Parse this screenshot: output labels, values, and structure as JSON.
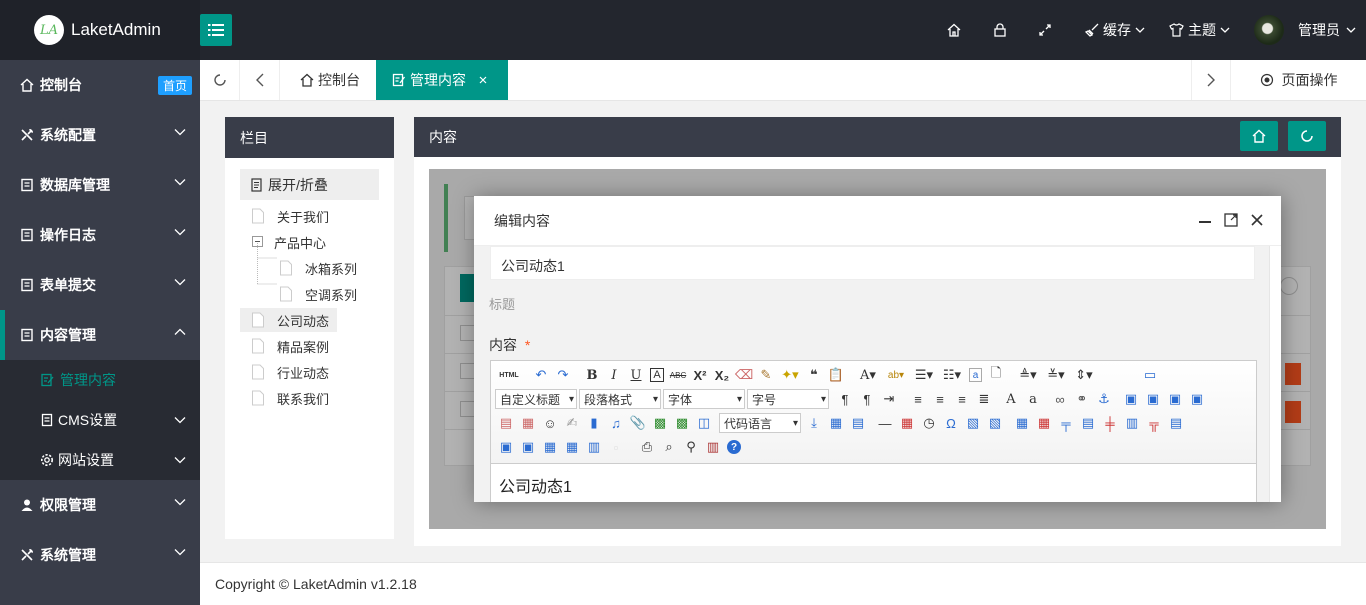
{
  "app": {
    "logo_mark": "LA",
    "name": "LaketAdmin"
  },
  "header": {
    "cache_label": "缓存",
    "theme_label": "主题",
    "user_label": "管理员"
  },
  "sidebar": {
    "items": [
      {
        "label": "控制台",
        "badge": "首页"
      },
      {
        "label": "系统配置"
      },
      {
        "label": "数据库管理"
      },
      {
        "label": "操作日志"
      },
      {
        "label": "表单提交"
      },
      {
        "label": "内容管理"
      },
      {
        "label": "权限管理"
      },
      {
        "label": "系统管理"
      }
    ],
    "sub_items": [
      {
        "label": "管理内容"
      },
      {
        "label": "CMS设置"
      },
      {
        "label": "网站设置"
      }
    ]
  },
  "tabs": [
    {
      "label": "控制台"
    },
    {
      "label": "管理内容"
    }
  ],
  "page_ops_label": "页面操作",
  "left_panel": {
    "title": "栏目",
    "toggle_label": "展开/折叠",
    "nodes": [
      "关于我们",
      "产品中心",
      "冰箱系列",
      "空调系列",
      "公司动态",
      "精品案例",
      "行业动态",
      "联系我们"
    ]
  },
  "right_panel": {
    "title": "内容"
  },
  "modal": {
    "title": "编辑内容",
    "title_value": "公司动态1",
    "title_label": "标题",
    "content_label": "内容",
    "required_mark": "*",
    "editor_text": "公司动态1",
    "selects": {
      "heading": "自定义标题",
      "paragraph": "段落格式",
      "font": "字体",
      "size": "字号",
      "code": "代码语言"
    }
  },
  "footer": {
    "copyright": "Copyright © LaketAdmin v1.2.18"
  },
  "colors": {
    "accent": "#009688",
    "dark": "#393d49",
    "header": "#23262e",
    "badge": "#1e9fff"
  }
}
